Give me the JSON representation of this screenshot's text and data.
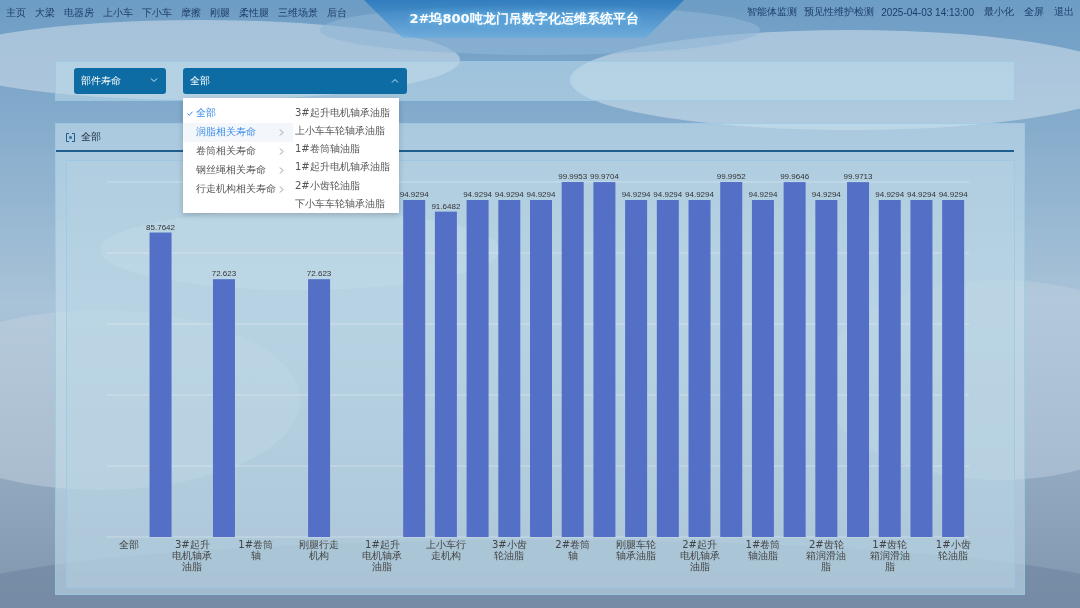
{
  "header": {
    "title": "2#坞800吨龙门吊数字化运维系统平台",
    "nav": [
      "主页",
      "大梁",
      "电器房",
      "上小车",
      "下小车",
      "摩擦",
      "刚腿",
      "柔性腿",
      "三维场景",
      "后台"
    ],
    "links": [
      "智能体监测",
      "预见性维护检测"
    ],
    "datetime": "2025-04-03 14:13:00",
    "actions": [
      "最小化",
      "全屏",
      "退出"
    ]
  },
  "filters": [
    {
      "value": "部件寿命",
      "expanded": false
    },
    {
      "value": "全部",
      "expanded": true
    }
  ],
  "menu": {
    "groups": [
      {
        "label": "全部",
        "selected": true,
        "has_children": false
      },
      {
        "label": "润脂相关寿命",
        "selected": false,
        "has_children": true,
        "hovered": true
      },
      {
        "label": "卷筒相关寿命",
        "selected": false,
        "has_children": true,
        "hovered": false
      },
      {
        "label": "钢丝绳相关寿命",
        "selected": false,
        "has_children": true,
        "hovered": false
      },
      {
        "label": "行走机构相关寿命",
        "selected": false,
        "has_children": true,
        "hovered": false
      }
    ],
    "submenu": [
      "3#起升电机轴承油脂",
      "上小车车轮轴承油脂",
      "1#卷筒轴油脂",
      "1#起升电机轴承油脂",
      "2#小齿轮油脂",
      "下小车车轮轴承油脂"
    ]
  },
  "panel": {
    "title": "全部",
    "chart_data": {
      "type": "bar",
      "categories": [
        "全部",
        null,
        "3#起升电机轴承油脂",
        null,
        "1#卷筒轴",
        null,
        "刚腿行走机构",
        null,
        "1#起升电机轴承油脂",
        null,
        "上小车行走机构",
        null,
        "3#小齿轮油脂",
        null,
        "2#卷筒轴",
        null,
        "刚腿车轮轴承油脂",
        null,
        "2#起升电机轴承油脂",
        null,
        "1#卷筒轴油脂",
        null,
        "2#齿轮箱润滑油脂",
        null,
        "1#齿轮箱润滑油脂",
        null,
        "1#小齿轮油脂"
      ],
      "values": [
        null,
        85.7642,
        null,
        72.623,
        null,
        null,
        72.623,
        null,
        null,
        94.9294,
        91.6482,
        94.9294,
        94.9294,
        94.9294,
        99.9953,
        99.9704,
        94.9294,
        94.9294,
        94.9294,
        99.9952,
        94.9294,
        99.9646,
        94.9294,
        99.9713,
        94.9294,
        94.9294,
        94.9294
      ],
      "value_labels": [
        null,
        "85.7642",
        null,
        "72.623",
        null,
        null,
        "72.623",
        null,
        null,
        "94.9294",
        "91.6482",
        "94.9294",
        "94.9294",
        "94.9294",
        "99.9953",
        "99.9704",
        "94.9294",
        "94.9294",
        "94.9294",
        "99.9952",
        "94.9294",
        "99.9646",
        "94.9294",
        "99.9713",
        "94.9294",
        "94.9294",
        "94.9294"
      ],
      "ylim": [
        0,
        100
      ],
      "color": "#5470c6"
    }
  }
}
